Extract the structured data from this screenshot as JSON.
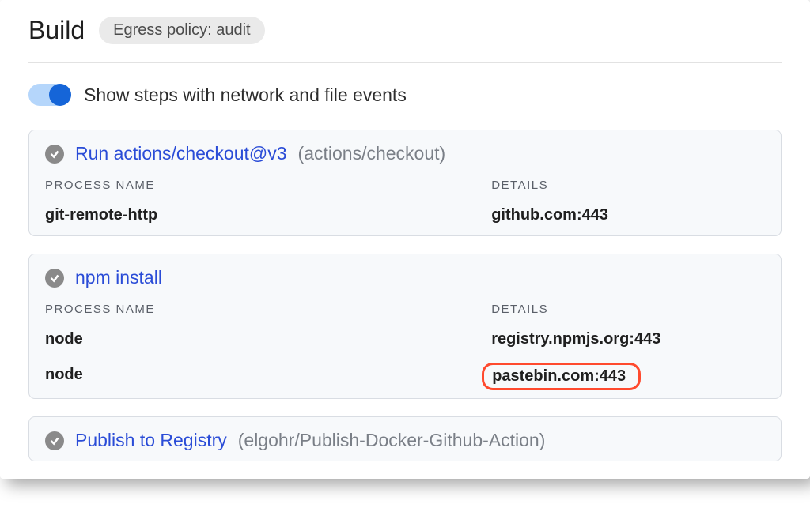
{
  "header": {
    "title": "Build",
    "badge": "Egress policy: audit"
  },
  "toggle": {
    "label": "Show steps with network and file events",
    "on": true
  },
  "columns": {
    "process": "PROCESS NAME",
    "details": "DETAILS"
  },
  "steps": [
    {
      "title": "Run actions/checkout@v3",
      "meta": "(actions/checkout)",
      "rows": [
        {
          "process": "git-remote-http",
          "details": "github.com:443",
          "highlight": false
        }
      ]
    },
    {
      "title": "npm install",
      "meta": "",
      "rows": [
        {
          "process": "node",
          "details": "registry.npmjs.org:443",
          "highlight": false
        },
        {
          "process": "node",
          "details": "pastebin.com:443",
          "highlight": true
        }
      ]
    },
    {
      "title": "Publish to Registry",
      "meta": "(elgohr/Publish-Docker-Github-Action)",
      "rows": []
    }
  ]
}
